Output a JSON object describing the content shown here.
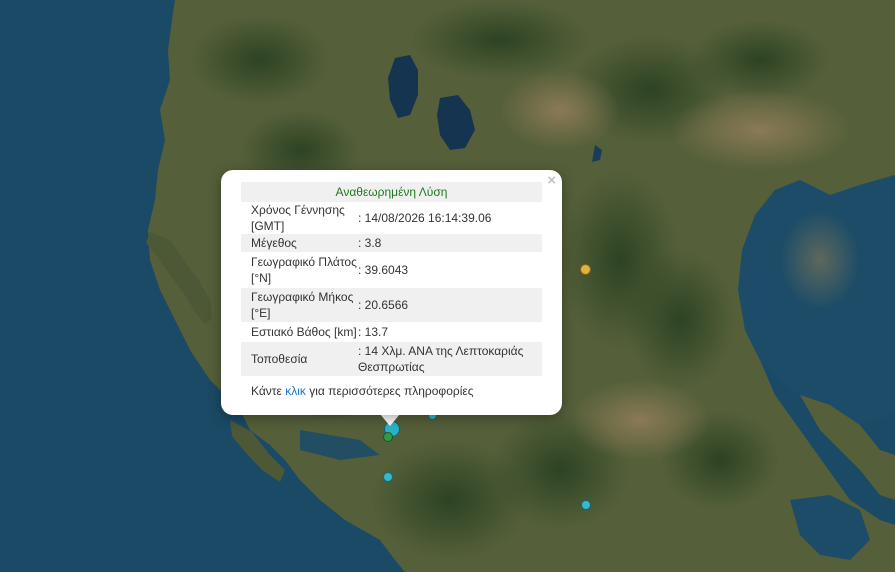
{
  "map": {
    "colors": {
      "sea": "#1b4a66",
      "land": "#4f5b35",
      "forest": "#2f4526",
      "lake": "#15344f"
    },
    "markers": [
      {
        "id": "quake-main",
        "color": "#2bb3c8",
        "size": "large"
      },
      {
        "id": "quake-green",
        "color": "#2e9b46",
        "size": "small"
      },
      {
        "id": "quake-yellow",
        "color": "#e0b43a",
        "size": "small"
      },
      {
        "id": "quake-cyan-1",
        "color": "#36b8cf",
        "size": "small"
      },
      {
        "id": "quake-cyan-2",
        "color": "#36b8cf",
        "size": "small"
      },
      {
        "id": "quake-cyan-3",
        "color": "#36b8cf",
        "size": "small"
      }
    ]
  },
  "popup": {
    "close_symbol": "×",
    "title": "Αναθεωρημένη Λύση",
    "rows": [
      {
        "label": "Χρόνος Γέννησης [GMT]",
        "value": ": 14/08/2026 16:14:39.06"
      },
      {
        "label": "Μέγεθος",
        "value": ": 3.8"
      },
      {
        "label": "Γεωγραφικό Πλάτος [°N]",
        "value": ": 39.6043"
      },
      {
        "label": "Γεωγραφικό Μήκος [°E]",
        "value": ": 20.6566"
      },
      {
        "label": "Εστιακό Βάθος [km]",
        "value": ": 13.7"
      },
      {
        "label": "Τοποθεσία",
        "value": ": 14 Χλμ. ΑΝΑ της Λεπτοκαριάς Θεσπρωτίας"
      }
    ],
    "more_prefix": "Κάντε ",
    "more_link": "κλικ",
    "more_suffix": " για περισσότερες πληροφορίες"
  }
}
